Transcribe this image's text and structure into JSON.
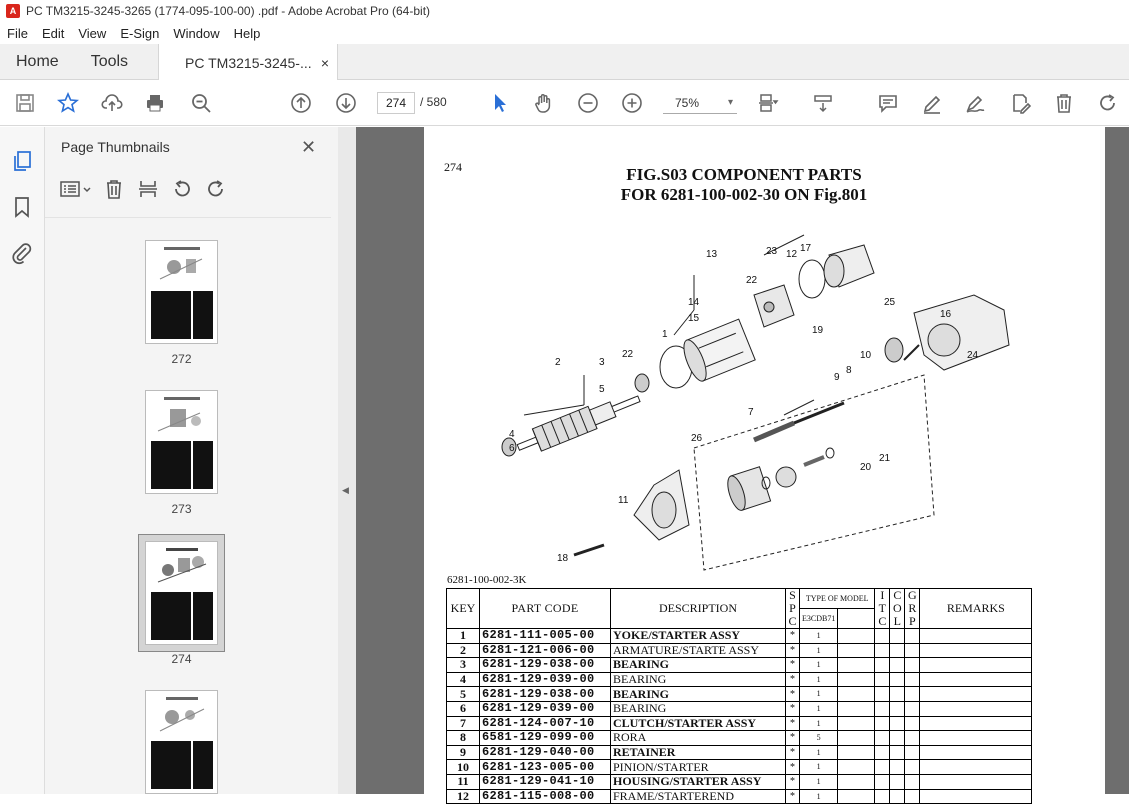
{
  "window": {
    "title": "PC TM3215-3245-3265 (1774-095-100-00) .pdf - Adobe Acrobat Pro (64-bit)"
  },
  "menu": [
    "File",
    "Edit",
    "View",
    "E-Sign",
    "Window",
    "Help"
  ],
  "tabs": {
    "home": "Home",
    "tools": "Tools",
    "doc": "PC TM3215-3245-...",
    "close": "×"
  },
  "toolbar": {
    "page_current": "274",
    "page_total": "/  580",
    "zoom": "75%"
  },
  "panel": {
    "title": "Page Thumbnails",
    "close": "✕",
    "thumbs": [
      {
        "label": "272"
      },
      {
        "label": "273"
      },
      {
        "label": "274"
      },
      {
        "label": ""
      }
    ]
  },
  "page": {
    "number": "274",
    "title_line1": "FIG.S03  COMPONENT PARTS",
    "title_line2": "FOR 6281-100-002-30 ON Fig.801",
    "subassembly": "6281-100-002-3K",
    "diagram_labels": [
      "13",
      "23",
      "12",
      "17",
      "22",
      "19",
      "14",
      "15",
      "1",
      "25",
      "16",
      "2",
      "3",
      "5",
      "22",
      "10",
      "9",
      "8",
      "24",
      "4",
      "6",
      "26",
      "7",
      "20",
      "21",
      "11",
      "18"
    ],
    "table": {
      "headers": {
        "key": "KEY",
        "code": "PART CODE",
        "desc": "DESCRIPTION",
        "spc": "S P C",
        "model": "TYPE OF MODEL",
        "model_sub": "E3CDB71",
        "itc": "I T C",
        "col": "C O L",
        "grp": "G R P",
        "remarks": "REMARKS"
      },
      "rows": [
        {
          "key": "1",
          "code": "6281-111-005-00",
          "desc": "YOKE/STARTER   ASSY",
          "spc": "*",
          "qty": "1"
        },
        {
          "key": "2",
          "code": "6281-121-006-00",
          "desc": "ARMATURE/STARTE ASSY",
          "spc": "*",
          "qty": "1"
        },
        {
          "key": "3",
          "code": "6281-129-038-00",
          "desc": "BEARING",
          "spc": "*",
          "qty": "1"
        },
        {
          "key": "4",
          "code": "6281-129-039-00",
          "desc": "BEARING",
          "spc": "*",
          "qty": "1"
        },
        {
          "key": "5",
          "code": "6281-129-038-00",
          "desc": "BEARING",
          "spc": "*",
          "qty": "1"
        },
        {
          "key": "6",
          "code": "6281-129-039-00",
          "desc": "BEARING",
          "spc": "*",
          "qty": "1"
        },
        {
          "key": "7",
          "code": "6281-124-007-10",
          "desc": "CLUTCH/STARTER  ASSY",
          "spc": "*",
          "qty": "1"
        },
        {
          "key": "8",
          "code": "6581-129-099-00",
          "desc": "RORA",
          "spc": "*",
          "qty": "5"
        },
        {
          "key": "9",
          "code": "6281-129-040-00",
          "desc": "RETAINER",
          "spc": "*",
          "qty": "1"
        },
        {
          "key": "10",
          "code": "6281-123-005-00",
          "desc": "PINION/STARTER",
          "spc": "*",
          "qty": "1"
        },
        {
          "key": "11",
          "code": "6281-129-041-10",
          "desc": "HOUSING/STARTER ASSY",
          "spc": "*",
          "qty": "1"
        },
        {
          "key": "12",
          "code": "6281-115-008-00",
          "desc": "FRAME/STARTEREND",
          "spc": "*",
          "qty": "1"
        }
      ]
    }
  }
}
